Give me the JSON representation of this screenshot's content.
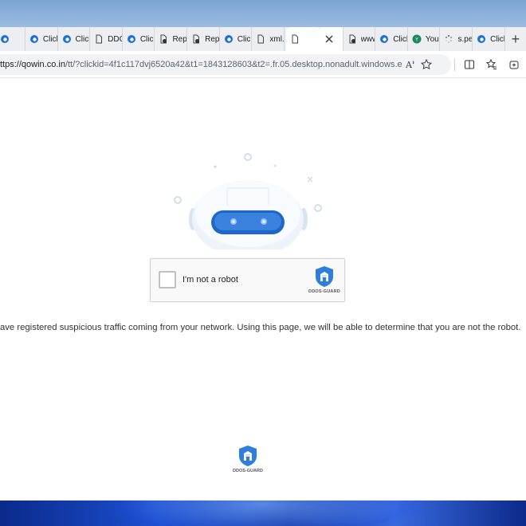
{
  "tabs": [
    {
      "label": "",
      "icon": "edge-icon"
    },
    {
      "label": "Click",
      "icon": "edge-icon"
    },
    {
      "label": "Click",
      "icon": "edge-icon"
    },
    {
      "label": "DDC",
      "icon": "page-icon"
    },
    {
      "label": "Click",
      "icon": "edge-icon"
    },
    {
      "label": "Repo",
      "icon": "blocked-page-icon"
    },
    {
      "label": "Repo",
      "icon": "blocked-page-icon"
    },
    {
      "label": "Click",
      "icon": "edge-icon"
    },
    {
      "label": "xml.p",
      "icon": "page-icon"
    },
    {
      "label": "",
      "icon": "page-icon",
      "active": true
    },
    {
      "label": "www.",
      "icon": "blocked-page-icon"
    },
    {
      "label": "Click",
      "icon": "edge-icon"
    },
    {
      "label": "Your",
      "icon": "youtube-icon"
    },
    {
      "label": "s.per",
      "icon": "loading-icon"
    },
    {
      "label": "Click",
      "icon": "edge-icon"
    }
  ],
  "address_bar": {
    "url_host": "ttps://qowin.co.in",
    "url_rest": "/tt/?clickid=4f1c117dvj6520a42&t1=1843128603&t2=.fr.05.desktop.nonadult.windows.edge"
  },
  "captcha": {
    "label": "I'm not a robot",
    "brand": "DDOS-GUARD"
  },
  "notice": "ave registered suspicious traffic coming from your network. Using this page, we will be able to determine that you are not the robot.",
  "footer": {
    "brand": "DDOS-GUARD"
  },
  "colors": {
    "shield_blue": "#2f7fd8",
    "robot_visor": "#1f66c9",
    "tab_strip": "#eceef2"
  }
}
